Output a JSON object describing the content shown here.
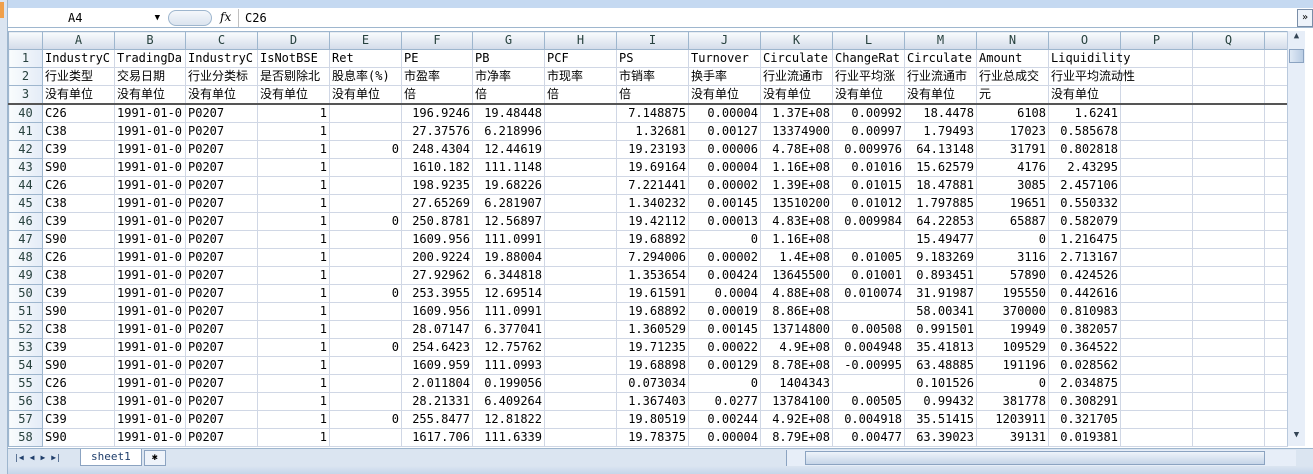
{
  "formula_bar": {
    "name_box": "A4",
    "fx_label": "fx",
    "value": "C26"
  },
  "columns": [
    "A",
    "B",
    "C",
    "D",
    "E",
    "F",
    "G",
    "H",
    "I",
    "J",
    "K",
    "L",
    "M",
    "N",
    "O",
    "P",
    "Q"
  ],
  "header_rows": [
    {
      "row": "1",
      "cells": [
        "IndustryC",
        "TradingDa",
        "IndustryC",
        "IsNotBSE",
        "Ret",
        "PE",
        "PB",
        "PCF",
        "PS",
        "Turnover",
        "Circulate",
        "ChangeRat",
        "Circulate",
        "Amount",
        "Liquidility",
        "",
        ""
      ]
    },
    {
      "row": "2",
      "cells": [
        "行业类型",
        "交易日期",
        "行业分类标",
        "是否剔除北",
        "股息率(%)",
        "市盈率",
        "市净率",
        "市现率",
        "市销率",
        "换手率",
        "行业流通市",
        "行业平均涨",
        "行业流通市",
        "行业总成交",
        "行业平均流动性",
        "",
        ""
      ]
    },
    {
      "row": "3",
      "cells": [
        "没有单位",
        "没有单位",
        "没有单位",
        "没有单位",
        "没有单位",
        "倍",
        "倍",
        "倍",
        "倍",
        "没有单位",
        "没有单位",
        "没有单位",
        "没有单位",
        "元",
        "没有单位",
        "",
        ""
      ]
    }
  ],
  "rows": [
    {
      "row": "40",
      "cells": [
        "C26",
        "1991-01-0",
        "P0207",
        "1",
        "",
        "196.9246",
        "19.48448",
        "",
        "7.148875",
        "0.00004",
        "1.37E+08",
        "0.00992",
        "18.4478",
        "6108",
        "1.6241",
        "",
        ""
      ]
    },
    {
      "row": "41",
      "cells": [
        "C38",
        "1991-01-0",
        "P0207",
        "1",
        "",
        "27.37576",
        "6.218996",
        "",
        "1.32681",
        "0.00127",
        "13374900",
        "0.00997",
        "1.79493",
        "17023",
        "0.585678",
        "",
        ""
      ]
    },
    {
      "row": "42",
      "cells": [
        "C39",
        "1991-01-0",
        "P0207",
        "1",
        "0",
        "248.4304",
        "12.44619",
        "",
        "19.23193",
        "0.00006",
        "4.78E+08",
        "0.009976",
        "64.13148",
        "31791",
        "0.802818",
        "",
        ""
      ]
    },
    {
      "row": "43",
      "cells": [
        "S90",
        "1991-01-0",
        "P0207",
        "1",
        "",
        "1610.182",
        "111.1148",
        "",
        "19.69164",
        "0.00004",
        "1.16E+08",
        "0.01016",
        "15.62579",
        "4176",
        "2.43295",
        "",
        ""
      ]
    },
    {
      "row": "44",
      "cells": [
        "C26",
        "1991-01-0",
        "P0207",
        "1",
        "",
        "198.9235",
        "19.68226",
        "",
        "7.221441",
        "0.00002",
        "1.39E+08",
        "0.01015",
        "18.47881",
        "3085",
        "2.457106",
        "",
        ""
      ]
    },
    {
      "row": "45",
      "cells": [
        "C38",
        "1991-01-0",
        "P0207",
        "1",
        "",
        "27.65269",
        "6.281907",
        "",
        "1.340232",
        "0.00145",
        "13510200",
        "0.01012",
        "1.797885",
        "19651",
        "0.550332",
        "",
        ""
      ]
    },
    {
      "row": "46",
      "cells": [
        "C39",
        "1991-01-0",
        "P0207",
        "1",
        "0",
        "250.8781",
        "12.56897",
        "",
        "19.42112",
        "0.00013",
        "4.83E+08",
        "0.009984",
        "64.22853",
        "65887",
        "0.582079",
        "",
        ""
      ]
    },
    {
      "row": "47",
      "cells": [
        "S90",
        "1991-01-0",
        "P0207",
        "1",
        "",
        "1609.956",
        "111.0991",
        "",
        "19.68892",
        "0",
        "1.16E+08",
        "",
        "15.49477",
        "0",
        "1.216475",
        "",
        ""
      ]
    },
    {
      "row": "48",
      "cells": [
        "C26",
        "1991-01-0",
        "P0207",
        "1",
        "",
        "200.9224",
        "19.88004",
        "",
        "7.294006",
        "0.00002",
        "1.4E+08",
        "0.01005",
        "9.183269",
        "3116",
        "2.713167",
        "",
        ""
      ]
    },
    {
      "row": "49",
      "cells": [
        "C38",
        "1991-01-0",
        "P0207",
        "1",
        "",
        "27.92962",
        "6.344818",
        "",
        "1.353654",
        "0.00424",
        "13645500",
        "0.01001",
        "0.893451",
        "57890",
        "0.424526",
        "",
        ""
      ]
    },
    {
      "row": "50",
      "cells": [
        "C39",
        "1991-01-0",
        "P0207",
        "1",
        "0",
        "253.3955",
        "12.69514",
        "",
        "19.61591",
        "0.0004",
        "4.88E+08",
        "0.010074",
        "31.91987",
        "195550",
        "0.442616",
        "",
        ""
      ]
    },
    {
      "row": "51",
      "cells": [
        "S90",
        "1991-01-0",
        "P0207",
        "1",
        "",
        "1609.956",
        "111.0991",
        "",
        "19.68892",
        "0.00019",
        "8.86E+08",
        "",
        "58.00341",
        "370000",
        "0.810983",
        "",
        ""
      ]
    },
    {
      "row": "52",
      "cells": [
        "C38",
        "1991-01-0",
        "P0207",
        "1",
        "",
        "28.07147",
        "6.377041",
        "",
        "1.360529",
        "0.00145",
        "13714800",
        "0.00508",
        "0.991501",
        "19949",
        "0.382057",
        "",
        ""
      ]
    },
    {
      "row": "53",
      "cells": [
        "C39",
        "1991-01-0",
        "P0207",
        "1",
        "0",
        "254.6423",
        "12.75762",
        "",
        "19.71235",
        "0.00022",
        "4.9E+08",
        "0.004948",
        "35.41813",
        "109529",
        "0.364522",
        "",
        ""
      ]
    },
    {
      "row": "54",
      "cells": [
        "S90",
        "1991-01-0",
        "P0207",
        "1",
        "",
        "1609.959",
        "111.0993",
        "",
        "19.68898",
        "0.00129",
        "8.78E+08",
        "-0.00995",
        "63.48885",
        "191196",
        "0.028562",
        "",
        ""
      ]
    },
    {
      "row": "55",
      "cells": [
        "C26",
        "1991-01-0",
        "P0207",
        "1",
        "",
        "2.011804",
        "0.199056",
        "",
        "0.073034",
        "0",
        "1404343",
        "",
        "0.101526",
        "0",
        "2.034875",
        "",
        ""
      ]
    },
    {
      "row": "56",
      "cells": [
        "C38",
        "1991-01-0",
        "P0207",
        "1",
        "",
        "28.21331",
        "6.409264",
        "",
        "1.367403",
        "0.0277",
        "13784100",
        "0.00505",
        "0.99432",
        "381778",
        "0.308291",
        "",
        ""
      ]
    },
    {
      "row": "57",
      "cells": [
        "C39",
        "1991-01-0",
        "P0207",
        "1",
        "0",
        "255.8477",
        "12.81822",
        "",
        "19.80519",
        "0.00244",
        "4.92E+08",
        "0.004918",
        "35.51415",
        "1203911",
        "0.321705",
        "",
        ""
      ]
    },
    {
      "row": "58",
      "cells": [
        "S90",
        "1991-01-0",
        "P0207",
        "1",
        "",
        "1617.706",
        "111.6339",
        "",
        "19.78375",
        "0.00004",
        "8.79E+08",
        "0.00477",
        "63.39023",
        "39131",
        "0.019381",
        "",
        ""
      ]
    }
  ],
  "sheet_tabs": [
    "sheet1"
  ]
}
